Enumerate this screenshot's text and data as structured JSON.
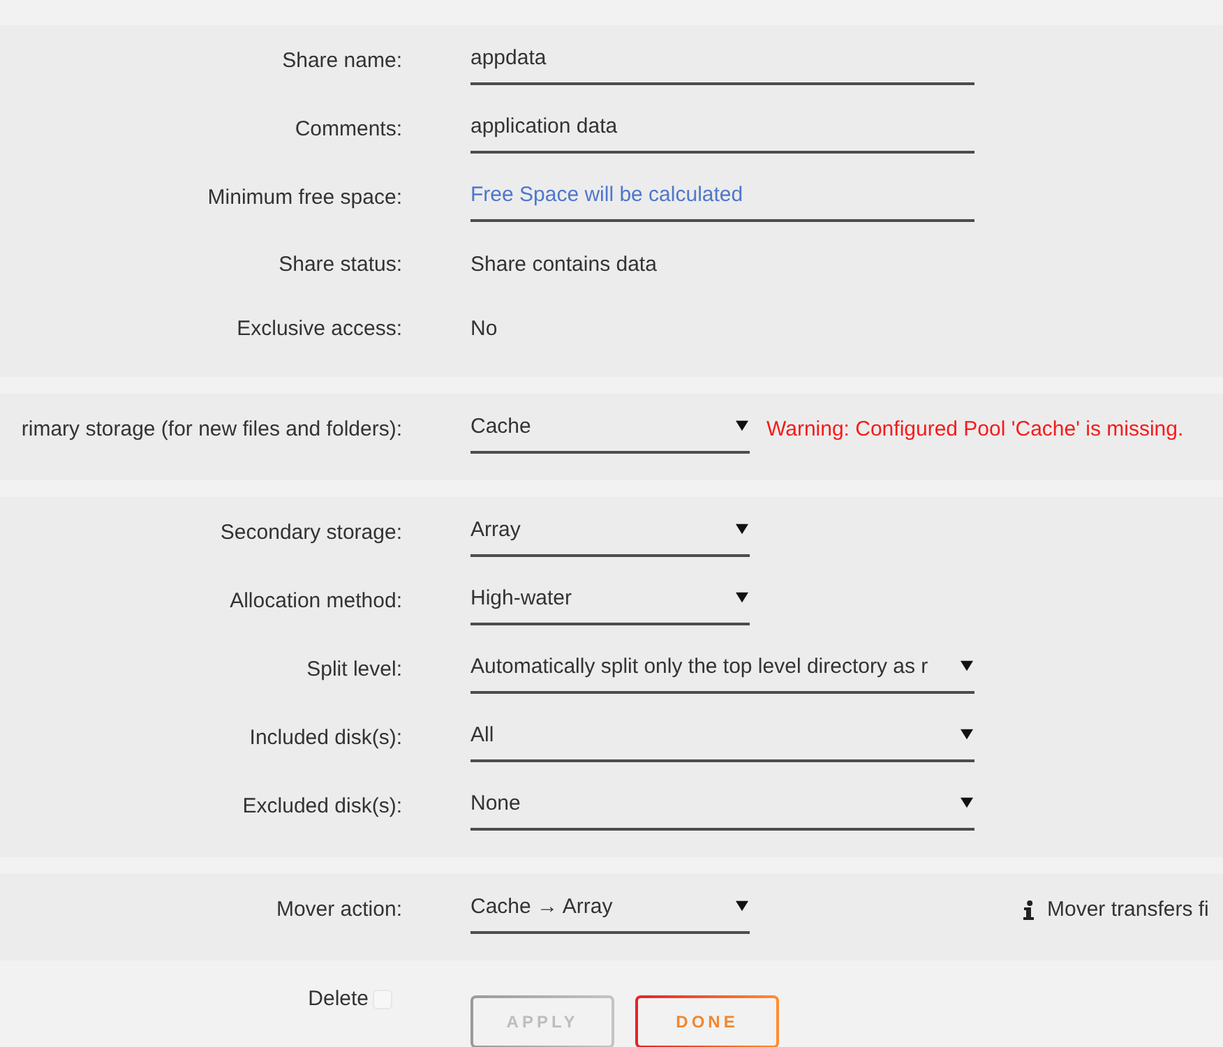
{
  "sections": [
    {
      "rows": [
        {
          "label": "Share name:",
          "kind": "text",
          "value": "appdata"
        },
        {
          "label": "Comments:",
          "kind": "text",
          "value": "application data"
        },
        {
          "label": "Minimum free space:",
          "kind": "text",
          "placeholder": "Free Space will be calculated"
        },
        {
          "label": "Share status:",
          "kind": "static",
          "value": "Share contains data"
        },
        {
          "label": "Exclusive access:",
          "kind": "static",
          "value": "No"
        }
      ]
    },
    {
      "rows": [
        {
          "label": "rimary storage (for new files and folders):",
          "kind": "select",
          "value": "Cache",
          "note": {
            "kind": "warning",
            "text": "Warning: Configured Pool 'Cache' is missing."
          }
        }
      ]
    },
    {
      "rows": [
        {
          "label": "Secondary storage:",
          "kind": "select",
          "value": "Array"
        },
        {
          "label": "Allocation method:",
          "kind": "select",
          "value": "High-water"
        },
        {
          "label": "Split level:",
          "kind": "select",
          "value": "Automatically split only the top level directory as r"
        },
        {
          "label": "Included disk(s):",
          "kind": "select",
          "value": "All"
        },
        {
          "label": "Excluded disk(s):",
          "kind": "select",
          "value": "None"
        }
      ]
    },
    {
      "rows": [
        {
          "label": "Mover action:",
          "kind": "select",
          "value": "Cache → Array",
          "note": {
            "kind": "info",
            "text": "Mover transfers fi"
          }
        }
      ]
    }
  ],
  "delete": {
    "label": "Delete",
    "checked": false
  },
  "buttons": [
    {
      "label": "APPLY",
      "disabled": true
    },
    {
      "label": "DONE",
      "disabled": false
    }
  ]
}
